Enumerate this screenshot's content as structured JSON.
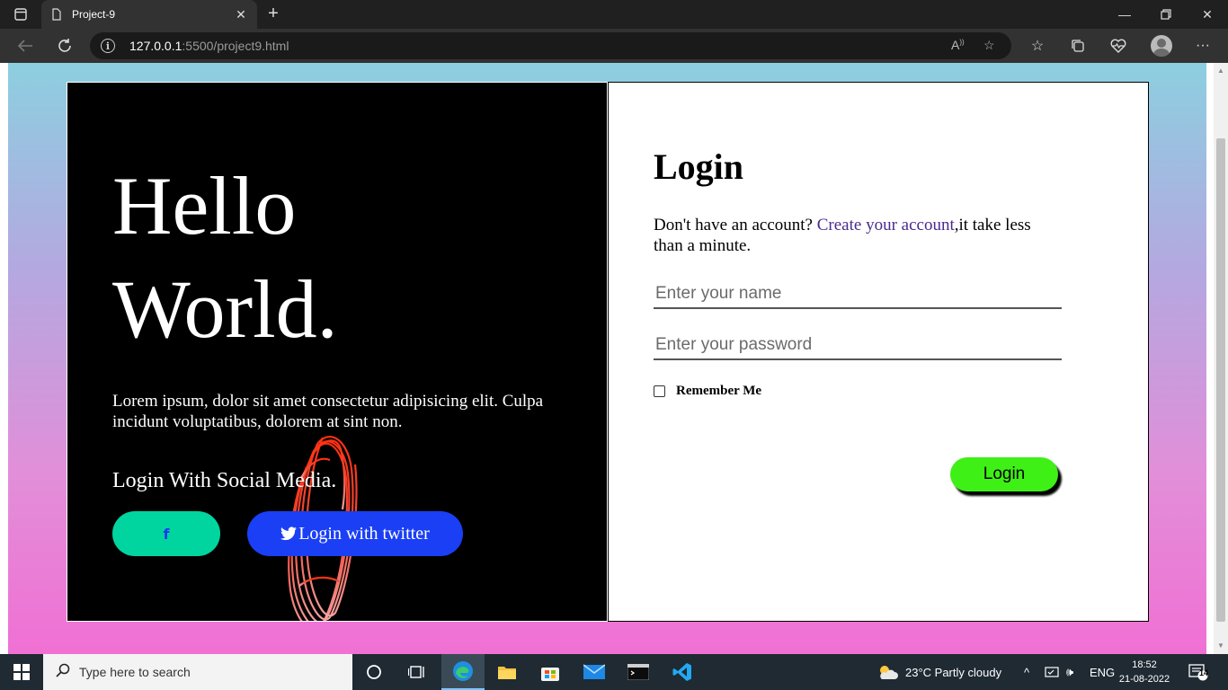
{
  "browser": {
    "tab_title": "Project-9",
    "url_host": "127.0.0.1",
    "url_path": ":5500/project9.html",
    "icons": [
      "tab-actions-icon",
      "page-icon",
      "close-tab-icon",
      "new-tab-icon",
      "minimize-icon",
      "restore-icon",
      "window-close-icon",
      "back-icon",
      "refresh-icon",
      "site-info-icon",
      "read-aloud-icon",
      "add-favorite-icon",
      "favorites-icon",
      "collections-icon",
      "browser-essentials-icon",
      "profile-icon",
      "more-icon"
    ]
  },
  "hero": {
    "line1": "Hello",
    "line2": "World.",
    "description": "Lorem ipsum, dolor sit amet consectetur adipisicing elit. Culpa incidunt voluptatibus, dolorem at sint non.",
    "social_heading": "Login With Social Media.",
    "facebook_label": "f",
    "twitter_label": "Login with twitter"
  },
  "login": {
    "title": "Login",
    "account_prefix": "Don't have an account? ",
    "create_link": "Create your account",
    "account_suffix": ",it take less than a minute.",
    "name_placeholder": "Enter your name",
    "password_placeholder": "Enter your password",
    "remember_label": "Remember Me",
    "submit_label": "Login"
  },
  "taskbar": {
    "search_placeholder": "Type here to search",
    "weather": "23°C  Partly cloudy",
    "language": "ENG",
    "time": "18:52",
    "date": "21-08-2022",
    "notification_count": "14"
  },
  "colors": {
    "facebook_button": "#00d5a0",
    "twitter_button": "#1a3ff5",
    "login_button": "#3ef016",
    "link": "#4b2a8e"
  }
}
